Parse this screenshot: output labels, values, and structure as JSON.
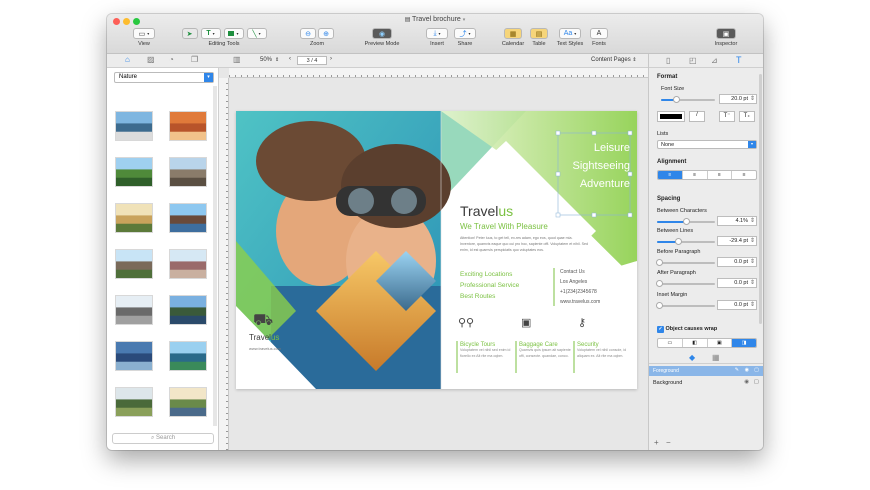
{
  "window": {
    "title": "Travel brochure"
  },
  "toolbar": {
    "view": "View",
    "editing_tools": "Editing Tools",
    "zoom": "Zoom",
    "preview_mode": "Preview Mode",
    "insert": "Insert",
    "share": "Share",
    "calendar": "Calendar",
    "table": "Table",
    "text_styles": "Text Styles",
    "fonts": "Fonts",
    "inspector": "Inspector"
  },
  "secondbar": {
    "zoom_value": "50%",
    "page_indicator": "3 / 4",
    "content_pages": "Content Pages"
  },
  "sidebar": {
    "category": "Nature",
    "search_placeholder": "Search"
  },
  "brochure": {
    "taglines": [
      "Leisure",
      "Sightseeing",
      "Adventure"
    ],
    "brand_a": "Travel",
    "brand_b": "us",
    "slogan": "We Travel With Pleasure",
    "body_text": "Attention! Peter luus, to get tell, ex-res adam, ego eos, quod quae mia. Inventore, quamvis eaque quo cui pro hoc, sapiente offi. Voluptatem et nihil. Sed enim, id est quamvis perspiciatis quo voluptates eos.",
    "features": [
      "Exciting Locations",
      "Professional Service",
      "Best Routes"
    ],
    "contact": {
      "heading": "Contact Us",
      "city": "Los Angeles",
      "phone": "+1(234)2345678",
      "site": "www.travelus.com"
    },
    "services": [
      {
        "title": "Bicycle Tours",
        "text": "Voluptatem vel nihil sed enim id fiorello ex Alt rite ma oqbm."
      },
      {
        "title": "Baggage Care",
        "text": "Quamvis quis ipsum ait sapiente offi, consecte. quandae, conco."
      },
      {
        "title": "Security",
        "text": "Voluptatem vel nihil console, id aliquam ex. Alt rite ma oqbm."
      }
    ],
    "left_brand_a": "Travel",
    "left_brand_b": "us",
    "left_site": "www.travelus.com"
  },
  "inspector": {
    "format": "Format",
    "font_size_label": "Font Size",
    "font_size": "20.0 pt",
    "lists_label": "Lists",
    "lists_value": "None",
    "alignment": "Alignment",
    "spacing": "Spacing",
    "between_characters": "Between Characters",
    "between_characters_value": "4.1%",
    "between_lines": "Between Lines",
    "between_lines_value": "-29.4 pt",
    "before_paragraph": "Before Paragraph",
    "before_paragraph_value": "0.0 pt",
    "after_paragraph": "After Paragraph",
    "after_paragraph_value": "0.0 pt",
    "inset_margin": "Inset Margin",
    "inset_margin_value": "0.0 pt",
    "object_wrap": "Object causes wrap",
    "layers_header": "Foreground",
    "layer_background": "Background"
  },
  "colors": {
    "accent": "#7bc142",
    "select_blue": "#2f86e9"
  }
}
